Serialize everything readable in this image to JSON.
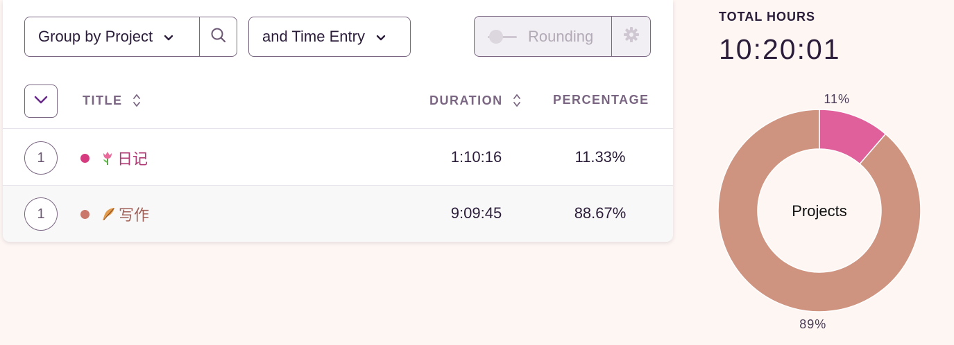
{
  "toolbar": {
    "group_by_label": "Group by Project",
    "secondary_group_label": "and Time Entry",
    "rounding_label": "Rounding",
    "rounding_enabled": false
  },
  "table": {
    "columns": {
      "title": "TITLE",
      "duration": "DURATION",
      "percentage": "PERCENTAGE"
    },
    "rows": [
      {
        "count": "1",
        "emoji": "tulip",
        "name": "日记",
        "duration": "1:10:16",
        "percentage": "11.33%",
        "color": "#d63b7f",
        "text_color": "#b03a74"
      },
      {
        "count": "1",
        "emoji": "feather",
        "name": "写作",
        "duration": "9:09:45",
        "percentage": "88.67%",
        "color": "#c9786b",
        "text_color": "#a06058"
      }
    ]
  },
  "summary": {
    "total_label": "TOTAL HOURS",
    "total_value": "10:20:01"
  },
  "chart_data": {
    "type": "pie",
    "center_label": "Projects",
    "slices": [
      {
        "name": "日记",
        "value": 11.33,
        "label": "11%",
        "color": "#e0609b"
      },
      {
        "name": "写作",
        "value": 88.67,
        "label": "89%",
        "color": "#cf9480"
      }
    ]
  }
}
